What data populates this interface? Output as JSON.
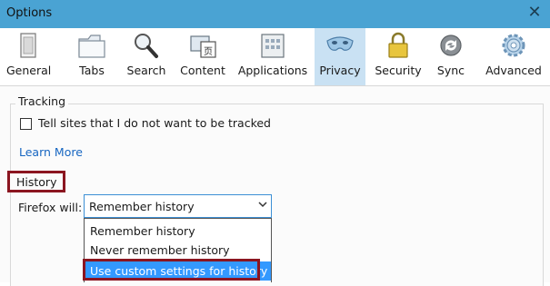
{
  "window": {
    "title": "Options",
    "close_glyph": "✕"
  },
  "toolbar": {
    "selected": "privacy",
    "items": [
      {
        "label": "General",
        "icon": "general-icon"
      },
      {
        "label": "Tabs",
        "icon": "tabs-icon"
      },
      {
        "label": "Search",
        "icon": "search-icon"
      },
      {
        "label": "Content",
        "icon": "content-icon"
      },
      {
        "label": "Applications",
        "icon": "applications-icon"
      },
      {
        "label": "Privacy",
        "icon": "privacy-mask-icon"
      },
      {
        "label": "Security",
        "icon": "security-lock-icon"
      },
      {
        "label": "Sync",
        "icon": "sync-icon"
      },
      {
        "label": "Advanced",
        "icon": "advanced-gear-icon"
      }
    ]
  },
  "tracking": {
    "legend": "Tracking",
    "checkbox_label": "Tell sites that I do not want to be tracked",
    "checked": false,
    "learn_more": "Learn More"
  },
  "history": {
    "legend": "History",
    "firefox_will_label": "Firefox will:",
    "selected_value": "Remember history",
    "options": [
      "Remember history",
      "Never remember history",
      "Use custom settings for history"
    ],
    "highlighted_option": "Use custom settings for history"
  },
  "colors": {
    "titlebar": "#4aa3d3",
    "selected_pane": "#c9e1f3",
    "link": "#1766c1",
    "highlight": "#3399ff",
    "annotation_box": "#8b1520"
  }
}
